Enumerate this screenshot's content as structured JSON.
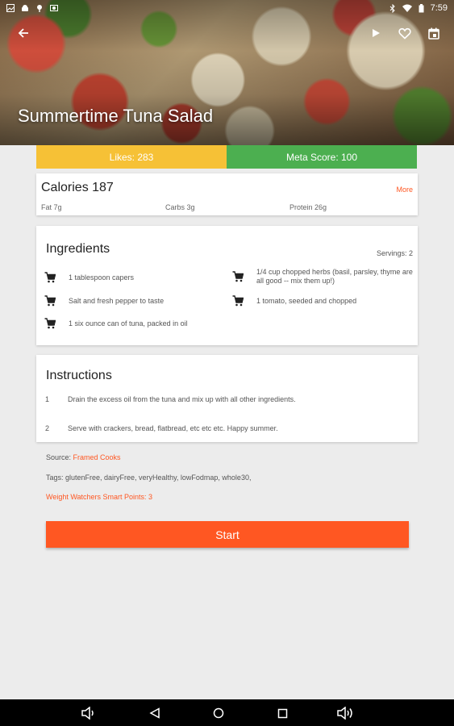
{
  "status_bar": {
    "time": "7:59"
  },
  "recipe": {
    "title": "Summertime Tuna Salad",
    "likes_label": "Likes: 283",
    "meta_score_label": "Meta Score: 100"
  },
  "nutrition": {
    "calories_label": "Calories 187",
    "more_label": "More",
    "fat_label": "Fat 7g",
    "carbs_label": "Carbs 3g",
    "protein_label": "Protein 26g"
  },
  "ingredients": {
    "heading": "Ingredients",
    "servings_label": "Servings: 2",
    "items": [
      "1 tablespoon capers",
      "1/4 cup chopped herbs (basil, parsley, thyme are all good -- mix them up!)",
      "Salt and fresh pepper to taste",
      "1 tomato, seeded and chopped",
      "1 six ounce can of tuna, packed in oil"
    ]
  },
  "instructions": {
    "heading": "Instructions",
    "steps": [
      {
        "num": "1",
        "text": "Drain the excess oil from the tuna and mix up with all other ingredients."
      },
      {
        "num": "2",
        "text": "Serve with crackers, bread, flatbread, etc etc etc. Happy summer."
      }
    ]
  },
  "details": {
    "source_prefix": "Source: ",
    "source_link": "Framed Cooks",
    "tags": "Tags: glutenFree, dairyFree, veryHealthy, lowFodmap, whole30,",
    "ww_points": "Weight Watchers Smart Points: 3"
  },
  "start_label": "Start",
  "colors": {
    "accent": "#ff5722",
    "likes": "#f6c136",
    "meta_score": "#4caf50"
  },
  "icons": {
    "app_bar": [
      "back-arrow-icon",
      "play-icon",
      "heart-outline-icon",
      "calendar-icon"
    ],
    "ingredient": "shopping-cart-icon",
    "nav": [
      "volume-down-icon",
      "back-triangle-icon",
      "home-circle-icon",
      "recents-square-icon",
      "volume-up-icon"
    ]
  }
}
